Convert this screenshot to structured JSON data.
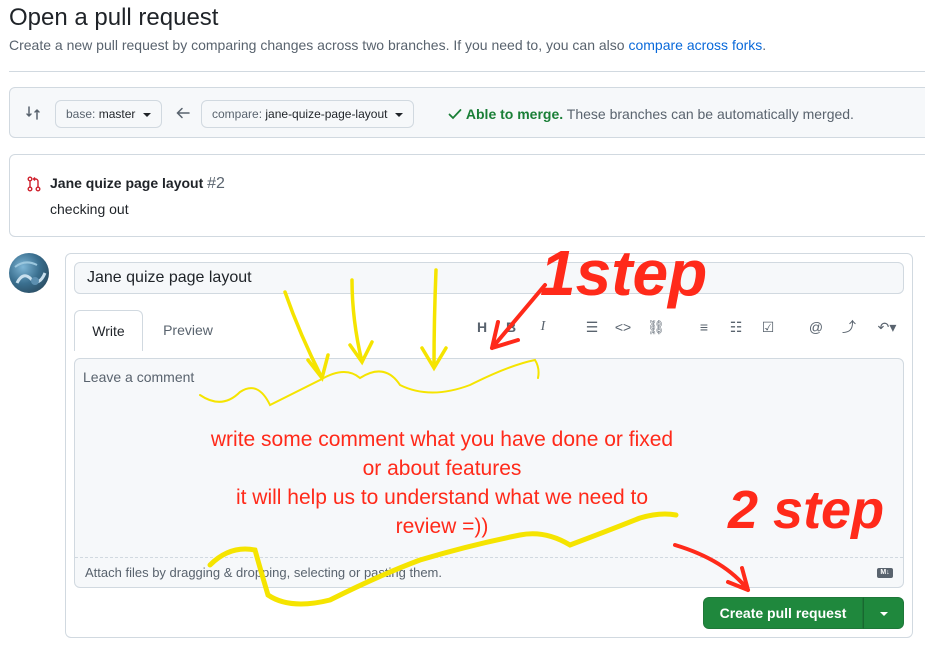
{
  "header": {
    "title": "Open a pull request",
    "subtitle": "Create a new pull request by comparing changes across two branches. If you need to, you can also",
    "subtitle_link": "compare across forks",
    "subtitle_end": "."
  },
  "compare": {
    "base_prefix": "base:",
    "base_branch": "master",
    "compare_prefix": "compare:",
    "compare_branch": "jane-quize-page-layout",
    "merge_ok": "Able to merge.",
    "merge_text": "These branches can be automatically merged."
  },
  "commit": {
    "title": "Jane quize page layout",
    "number": "#2",
    "description": "checking out"
  },
  "form": {
    "title_value": "Jane quize page layout",
    "tab_write": "Write",
    "tab_preview": "Preview",
    "comment_placeholder": "Leave a comment",
    "attach_text": "Attach files by dragging & dropping, selecting or pasting them.",
    "markdown_badge": "M↓",
    "submit_label": "Create pull request"
  },
  "toolbar": [
    "heading-icon",
    "bold-icon",
    "italic-icon",
    "quote-icon",
    "code-icon",
    "link-icon",
    "unordered-list-icon",
    "ordered-list-icon",
    "task-list-icon",
    "mention-icon",
    "reference-icon",
    "undo-icon"
  ],
  "annotations": {
    "step1": "1step",
    "step2": "2 step",
    "note_line1": "write some comment what you have done or fixed",
    "note_line2": "or about features",
    "note_line3": "it will help us to understand what we need to",
    "note_line4": "review =))"
  },
  "colors": {
    "accent_green": "#1f883d",
    "link_blue": "#0969da",
    "annotation_red": "#ff2a1a",
    "annotation_yellow": "#f5e400"
  }
}
